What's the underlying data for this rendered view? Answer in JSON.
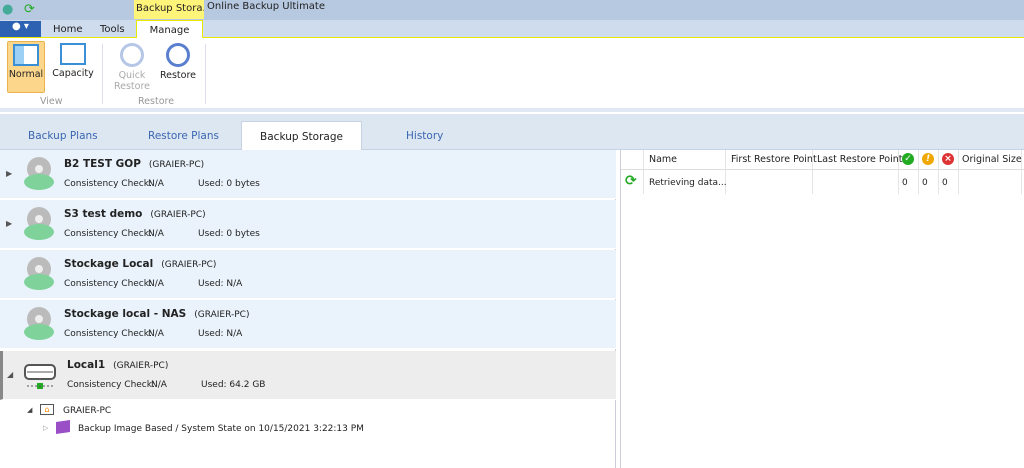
{
  "titlebar": {
    "context_tab": "Backup Stora...",
    "app_title": "Online Backup Ultimate"
  },
  "ribbon_tabs": [
    "Home",
    "Tools",
    "Manage"
  ],
  "ribbon": {
    "normal": "Normal",
    "capacity": "Capacity",
    "view_group": "View",
    "quick_restore": "Quick Restore",
    "restore": "Restore",
    "restore_group": "Restore"
  },
  "main_tabs": [
    "Backup Plans",
    "Restore Plans",
    "Backup Storage",
    "History"
  ],
  "storages": [
    {
      "name": "B2 TEST GOP",
      "host": "(GRAIER-PC)",
      "cc_label": "Consistency Check:",
      "cc": "N/A",
      "used": "Used: 0 bytes"
    },
    {
      "name": "S3 test demo",
      "host": "(GRAIER-PC)",
      "cc_label": "Consistency Check:",
      "cc": "N/A",
      "used": "Used: 0 bytes"
    },
    {
      "name": "Stockage Local",
      "host": "(GRAIER-PC)",
      "cc_label": "Consistency Check:",
      "cc": "N/A",
      "used": "Used: N/A"
    },
    {
      "name": "Stockage local - NAS",
      "host": "(GRAIER-PC)",
      "cc_label": "Consistency Check:",
      "cc": "N/A",
      "used": "Used: N/A"
    },
    {
      "name": "Local1",
      "host": "(GRAIER-PC)",
      "cc_label": "Consistency Check:",
      "cc": "N/A",
      "used": "Used: 64.2 GB"
    }
  ],
  "tree": {
    "computer": "GRAIER-PC",
    "backup": "Backup Image Based / System State on 10/15/2021 3:22:13 PM"
  },
  "grid": {
    "headers": {
      "name": "Name",
      "first": "First Restore Point",
      "last": "Last Restore Point",
      "original": "Original Size"
    },
    "row": {
      "name": "Retrieving data...",
      "ok": "0",
      "warn": "0",
      "err": "0"
    }
  }
}
